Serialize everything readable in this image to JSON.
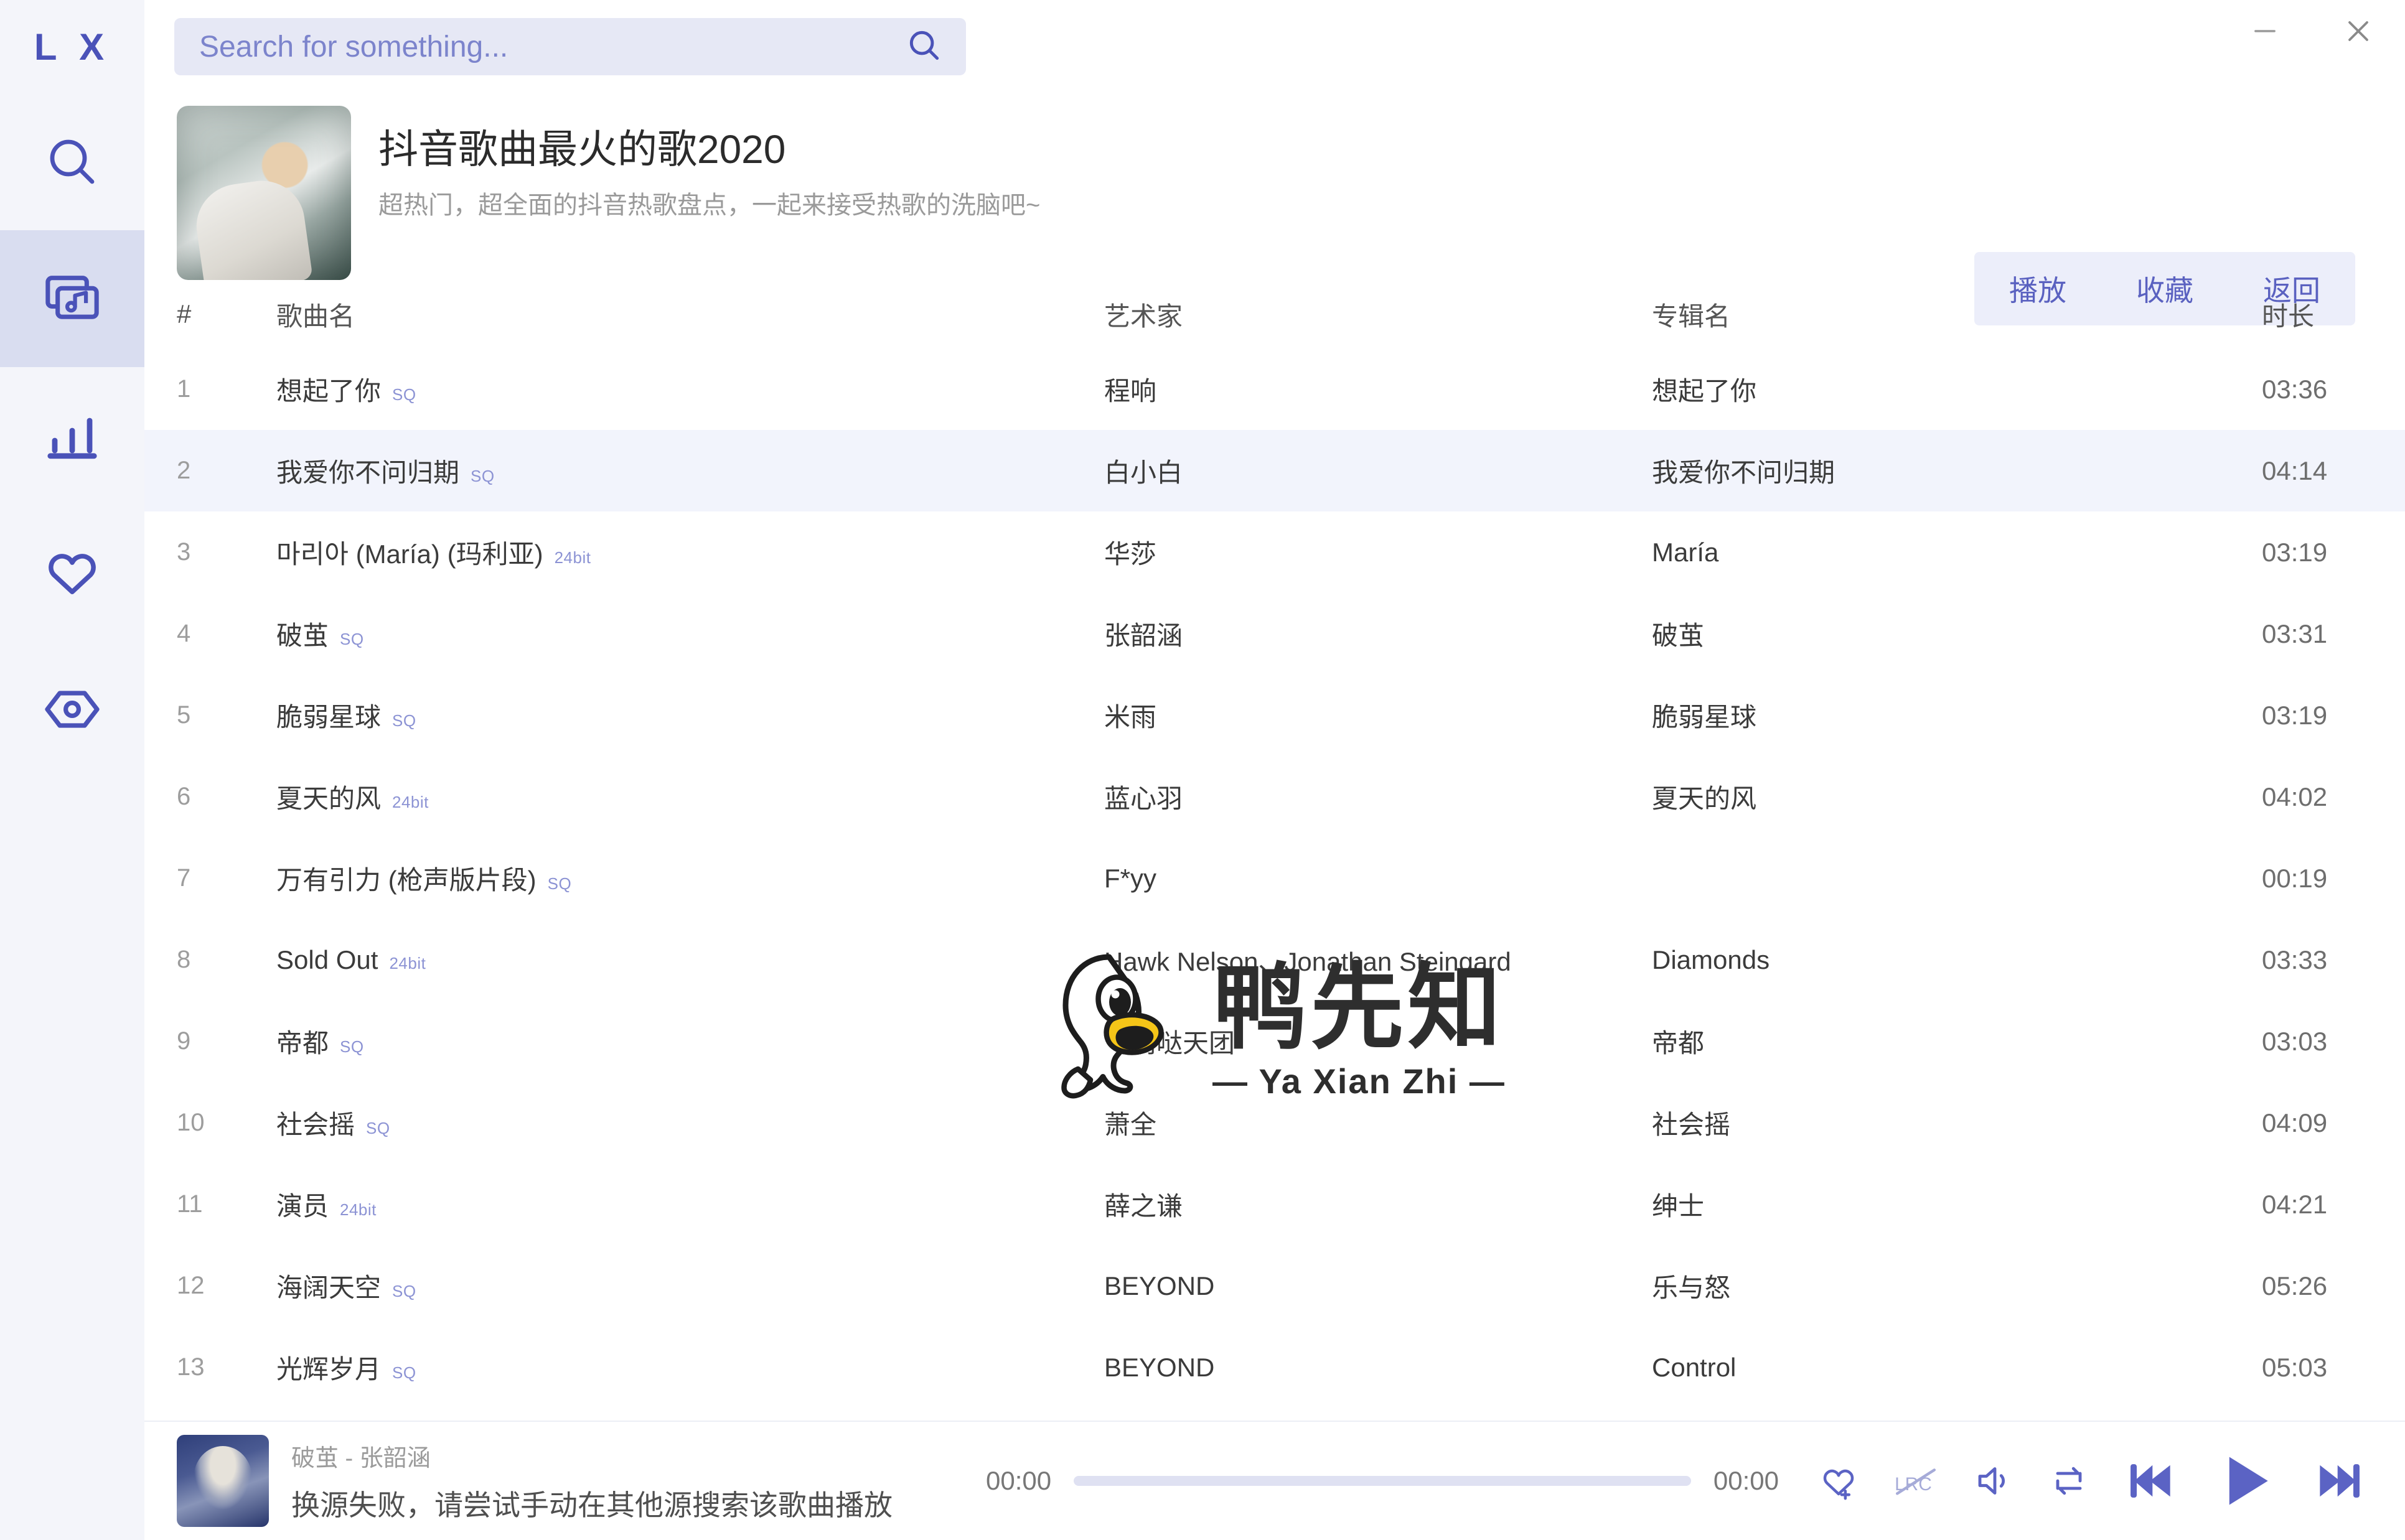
{
  "app": {
    "logo": "L X"
  },
  "window": {
    "minimize": "—",
    "close": "✕"
  },
  "search": {
    "value": "",
    "placeholder": "Search for something..."
  },
  "sidebar": {
    "items": [
      {
        "name": "search",
        "icon": "search-icon",
        "active": false
      },
      {
        "name": "playlist",
        "icon": "playlist-music-icon",
        "active": true
      },
      {
        "name": "leaderboard",
        "icon": "bar-chart-icon",
        "active": false
      },
      {
        "name": "favorites",
        "icon": "heart-icon",
        "active": false
      },
      {
        "name": "settings",
        "icon": "hexagon-eye-icon",
        "active": false
      }
    ]
  },
  "playlist": {
    "title": "抖音歌曲最火的歌2020",
    "subtitle": "超热门，超全面的抖音热歌盘点，一起来接受热歌的洗脑吧~",
    "actions": [
      {
        "label": "播放",
        "name": "play-playlist-button"
      },
      {
        "label": "收藏",
        "name": "favorite-playlist-button"
      },
      {
        "label": "返回",
        "name": "back-button"
      }
    ]
  },
  "table": {
    "headers": {
      "num": "#",
      "title": "歌曲名",
      "artist": "艺术家",
      "album": "专辑名",
      "duration": "时长"
    },
    "rows": [
      {
        "num": "1",
        "title": "想起了你",
        "badge": "SQ",
        "artist": "程响",
        "album": "想起了你",
        "duration": "03:36"
      },
      {
        "num": "2",
        "title": "我爱你不问归期",
        "badge": "SQ",
        "artist": "白小白",
        "album": "我爱你不问归期",
        "duration": "04:14"
      },
      {
        "num": "3",
        "title": "마리아 (María) (玛利亚)",
        "badge": "24bit",
        "artist": "华莎",
        "album": "María",
        "duration": "03:19"
      },
      {
        "num": "4",
        "title": "破茧",
        "badge": "SQ",
        "artist": "张韶涵",
        "album": "破茧",
        "duration": "03:31"
      },
      {
        "num": "5",
        "title": "脆弱星球",
        "badge": "SQ",
        "artist": "米雨",
        "album": "脆弱星球",
        "duration": "03:19"
      },
      {
        "num": "6",
        "title": "夏天的风",
        "badge": "24bit",
        "artist": "蓝心羽",
        "album": "夏天的风",
        "duration": "04:02"
      },
      {
        "num": "7",
        "title": "万有引力 (枪声版片段)",
        "badge": "SQ",
        "artist": "F*yy",
        "album": "",
        "duration": "00:19"
      },
      {
        "num": "8",
        "title": "Sold Out",
        "badge": "24bit",
        "artist": "Hawk Nelson、Jonathan Steingard",
        "album": "Diamonds",
        "duration": "03:33"
      },
      {
        "num": "9",
        "title": "帝都",
        "badge": "SQ",
        "artist": "萌萌哒天团",
        "album": "帝都",
        "duration": "03:03"
      },
      {
        "num": "10",
        "title": "社会摇",
        "badge": "SQ",
        "artist": "萧全",
        "album": "社会摇",
        "duration": "04:09"
      },
      {
        "num": "11",
        "title": "演员",
        "badge": "24bit",
        "artist": "薛之谦",
        "album": "绅士",
        "duration": "04:21"
      },
      {
        "num": "12",
        "title": "海阔天空",
        "badge": "SQ",
        "artist": "BEYOND",
        "album": "乐与怒",
        "duration": "05:26"
      },
      {
        "num": "13",
        "title": "光辉岁月",
        "badge": "SQ",
        "artist": "BEYOND",
        "album": "Control",
        "duration": "05:03"
      }
    ]
  },
  "watermark": {
    "cn": "鸭先知",
    "en": "— Ya Xian Zhi —"
  },
  "player": {
    "song": "破茧 - 张韶涵",
    "status": "换源失败，请尝试手动在其他源搜索该歌曲播放",
    "current_time": "00:00",
    "total_time": "00:00",
    "progress_percent": 0,
    "controls": [
      {
        "name": "add-favorite-icon"
      },
      {
        "name": "lrc-off-icon"
      },
      {
        "name": "volume-icon"
      },
      {
        "name": "repeat-icon"
      },
      {
        "name": "previous-icon"
      },
      {
        "name": "play-icon"
      },
      {
        "name": "next-icon"
      }
    ]
  },
  "colors": {
    "accent": "#5b63c4",
    "sidebar_bg": "#f4f5fa",
    "row_alt": "#f2f4fc",
    "badge": "#8c93d4"
  }
}
